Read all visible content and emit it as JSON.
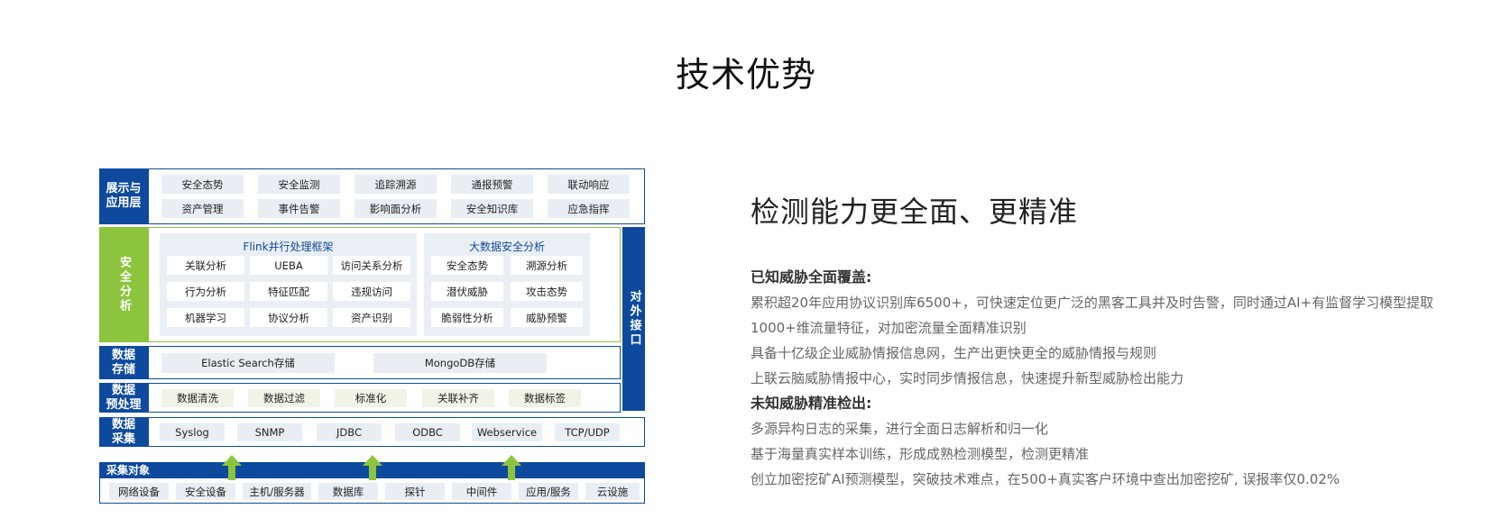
{
  "page": {
    "title": "技术优势"
  },
  "diagram": {
    "display_layer": {
      "label": "展示与\n应用层",
      "items": [
        "安全态势",
        "安全监测",
        "追踪溯源",
        "通报预警",
        "联动响应",
        "资产管理",
        "事件告警",
        "影响面分析",
        "安全知识库",
        "应急指挥"
      ]
    },
    "analysis_layer": {
      "label": "安全分析",
      "flink": {
        "title": "Flink并行处理框架",
        "items": [
          "关联分析",
          "UEBA",
          "访问关系分析",
          "行为分析",
          "特征匹配",
          "违规访问",
          "机器学习",
          "协议分析",
          "资产识别"
        ]
      },
      "bigdata": {
        "title": "大数据安全分析",
        "items": [
          "安全态势",
          "溯源分析",
          "潜伏威胁",
          "攻击态势",
          "脆弱性分析",
          "威胁预警"
        ]
      }
    },
    "external_interface": {
      "label": "对外接口"
    },
    "storage_layer": {
      "label": "数据\n存储",
      "items": [
        "Elastic Search存储",
        "MongoDB存储"
      ]
    },
    "preprocess_layer": {
      "label": "数据\n预处理",
      "items": [
        "数据清洗",
        "数据过滤",
        "标准化",
        "关联补齐",
        "数据标签"
      ]
    },
    "collect_layer": {
      "label": "数据\n采集",
      "items": [
        "Syslog",
        "SNMP",
        "JDBC",
        "ODBC",
        "Webservice",
        "TCP/UDP"
      ]
    },
    "targets": {
      "label": "采集对象",
      "items": [
        "网络设备",
        "安全设备",
        "主机/服务器",
        "数据库",
        "探针",
        "中间件",
        "应用/服务",
        "云设施"
      ]
    },
    "colors": {
      "blue": "#0d4a9e",
      "green": "#8cc43e",
      "arrow": "#8cc43e"
    }
  },
  "content": {
    "heading": "检测能力更全面、更精准",
    "known": {
      "title": "已知威胁全面覆盖:",
      "lines": [
        "累积超20年应用协议识别库6500+，可快速定位更广泛的黑客工具并及时告警，同时通过AI+有监督学习模型提取",
        "1000+维流量特征，对加密流量全面精准识别",
        "具备十亿级企业威胁情报信息网，生产出更快更全的威胁情报与规则",
        "上联云脑威胁情报中心，实时同步情报信息，快速提升新型威胁检出能力"
      ]
    },
    "unknown": {
      "title": "未知威胁精准检出:",
      "lines": [
        "多源异构日志的采集，进行全面日志解析和归一化",
        "基于海量真实样本训练，形成成熟检测模型，检测更精准",
        "创立加密挖矿AI预测模型，突破技术难点，在500+真实客户环境中查出加密挖矿, 误报率仅0.02%"
      ]
    }
  }
}
